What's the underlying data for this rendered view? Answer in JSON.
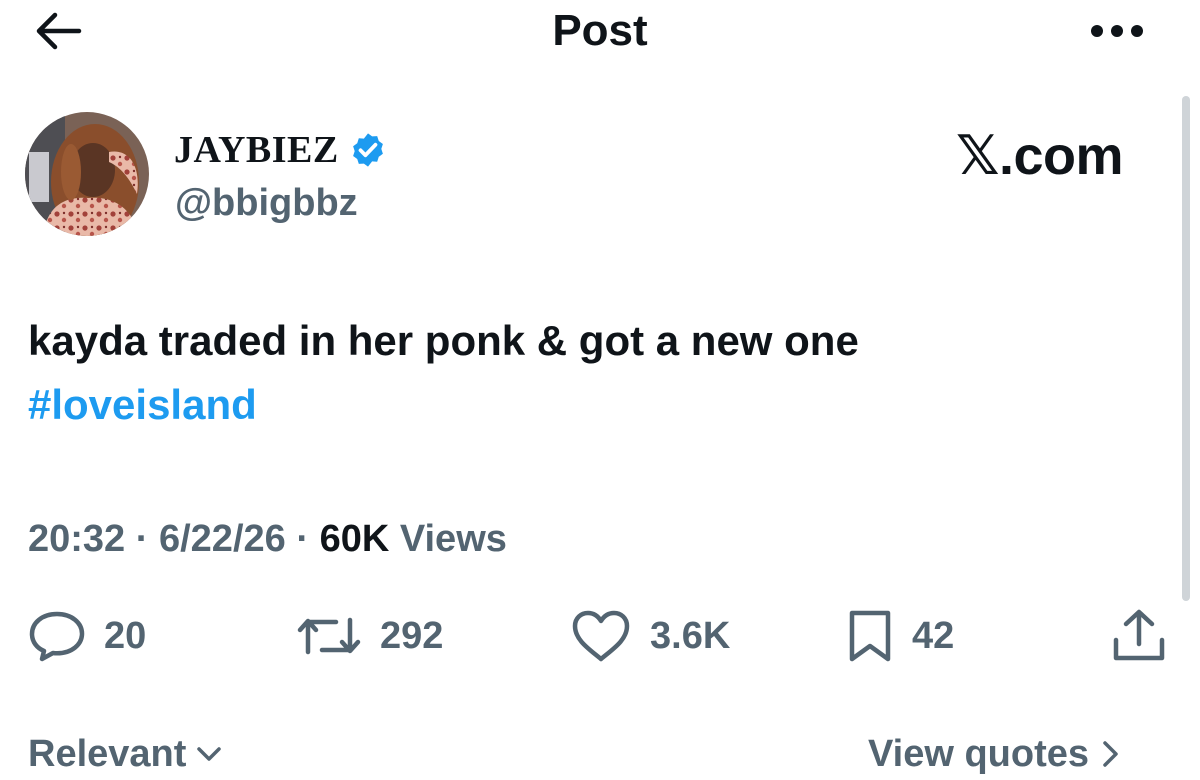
{
  "header": {
    "title": "Post",
    "back_icon": "arrow-left-icon",
    "more_icon": "more-horizontal-icon"
  },
  "author": {
    "name": "JAYBIEZ",
    "handle": "@bbigbbz",
    "verified_icon": "verified-badge-icon",
    "verified_color": "#1d9bf0"
  },
  "watermark": "𝕏.com",
  "tweet": {
    "text": "kayda traded in her ponk & got a new one",
    "hashtag": "#loveisland",
    "hashtag_color": "#1d9bf0"
  },
  "meta": {
    "time": "20:32",
    "separator": "·",
    "date": "6/22/26",
    "views_count": "60K",
    "views_label": "Views"
  },
  "actions": {
    "replies": "20",
    "reposts": "292",
    "likes": "3.6K",
    "bookmarks": "42",
    "reply_icon": "reply-bubble-icon",
    "repost_icon": "repost-icon",
    "like_icon": "heart-icon",
    "bookmark_icon": "bookmark-icon",
    "share_icon": "share-icon"
  },
  "footer": {
    "sort_label": "Relevant",
    "view_quotes_label": "View quotes"
  },
  "colors": {
    "text_primary": "#0f1419",
    "text_secondary": "#536471",
    "accent": "#1d9bf0"
  }
}
